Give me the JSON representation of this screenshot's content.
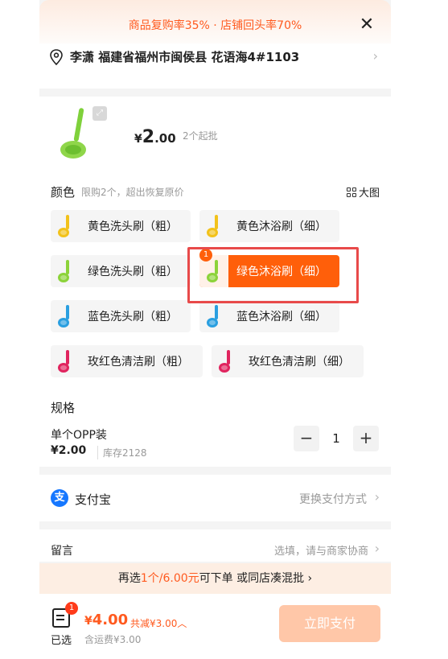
{
  "banner": {
    "text": "商品复购率35% · 店铺回头率70%"
  },
  "address": {
    "text": "李潇 福建省福州市闽侯县 花语海4#1103"
  },
  "product": {
    "price_yen": "¥",
    "price_int": "2",
    "price_dec": ".00",
    "moq": "2个起批"
  },
  "color": {
    "title": "颜色",
    "limit": "限购2个，超出恢复原价",
    "big_pic": "大图",
    "options": [
      {
        "label": "黄色洗头刷（粗）",
        "color": "#f2c21b"
      },
      {
        "label": "黄色沐浴刷（细）",
        "color": "#f2c21b"
      },
      {
        "label": "绿色洗头刷（粗）",
        "color": "#8cd33a"
      },
      {
        "label": "绿色沐浴刷（细）",
        "color": "#8cd33a",
        "badge": "1"
      },
      {
        "label": "蓝色洗头刷（粗）",
        "color": "#2a9fe0"
      },
      {
        "label": "蓝色沐浴刷（细）",
        "color": "#2a9fe0"
      },
      {
        "label": "玫红色清洁刷（粗）",
        "color": "#e0245e"
      },
      {
        "label": "玫红色清洁刷（细）",
        "color": "#e0245e"
      }
    ]
  },
  "spec": {
    "title": "规格",
    "name": "单个OPP装",
    "price": "¥2.00",
    "stock": "库存2128",
    "minus": "−",
    "qty": "1",
    "plus": "+"
  },
  "payment": {
    "icon_text": "支",
    "name": "支付宝",
    "change": "更换支付方式"
  },
  "message": {
    "title": "留言",
    "placeholder": "选填，请与商家协商"
  },
  "promo": {
    "prefix": "再选",
    "count": "1个/6.00元",
    "suffix": "可下单 或同店凑混批"
  },
  "footer": {
    "badge": "1",
    "selected_label": "已选",
    "total_yen": "¥",
    "total_amt": "4.00",
    "discount": "共减¥3.00",
    "shipping": "含运费¥3.00",
    "pay_button": "立即支付"
  },
  "colors": {
    "accent": "#ff5f0a",
    "highlight_box": "#e84a4a",
    "pay_disabled": "#ffc7a8"
  },
  "icons": [
    "close-icon",
    "location-pin-icon",
    "chevron-right-icon",
    "zoom-icon",
    "grid-icon",
    "alipay-icon",
    "cart-list-icon"
  ]
}
